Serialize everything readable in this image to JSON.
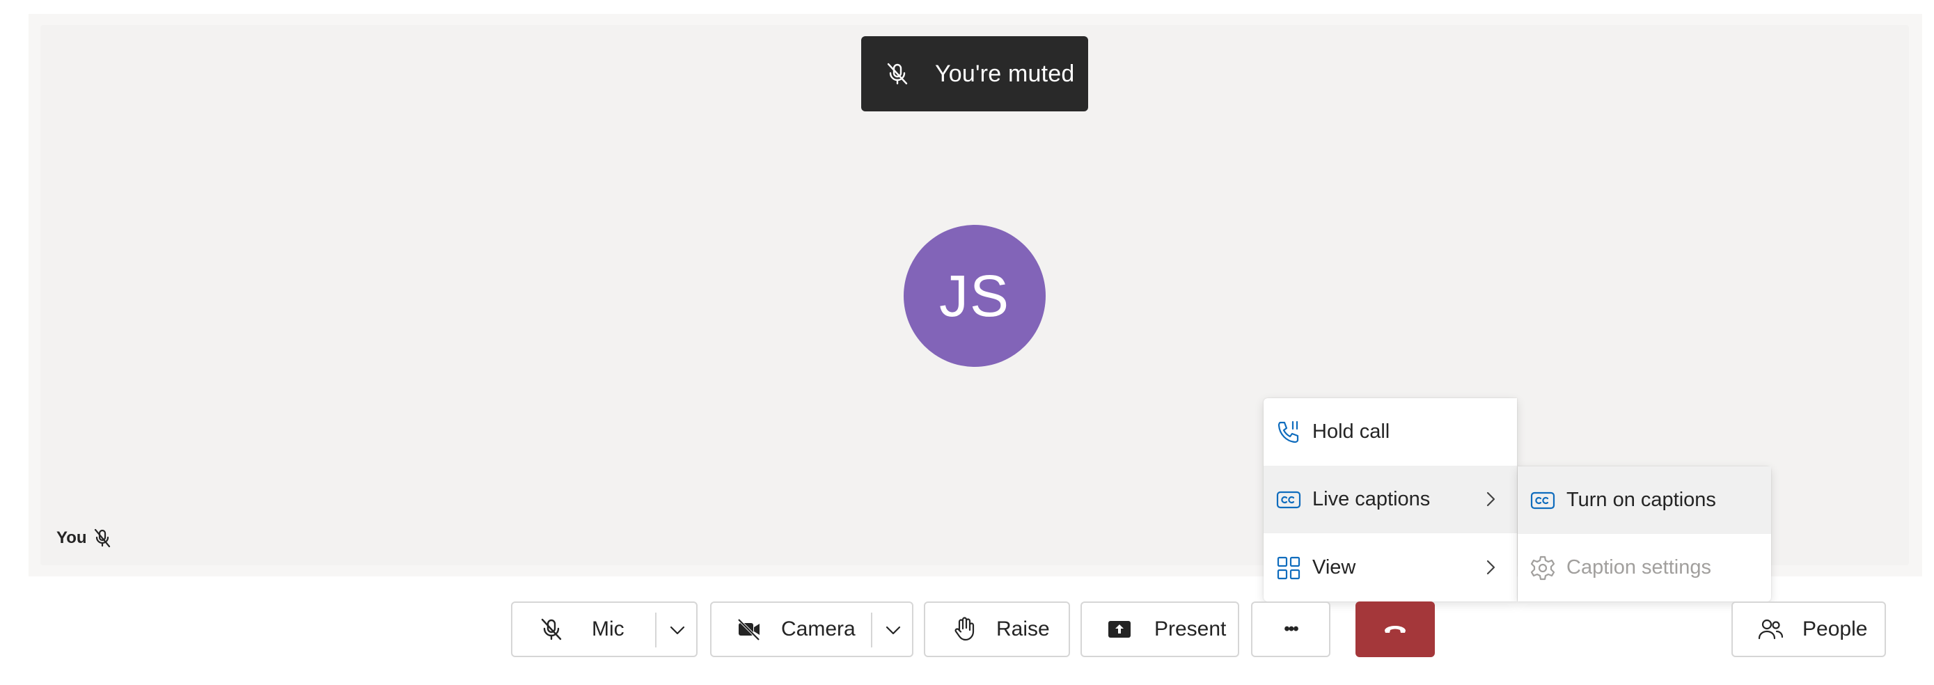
{
  "toast": {
    "text": "You're muted",
    "icon": "mic-off-icon"
  },
  "participant": {
    "initials": "JS",
    "avatar_color": "#8264b8",
    "self_label": "You",
    "self_icon": "mic-off-icon"
  },
  "more_menu": {
    "items": [
      {
        "label": "Hold call",
        "icon": "phone-hold-icon"
      },
      {
        "label": "Live captions",
        "icon": "closed-captions-icon",
        "has_submenu": true,
        "highlighted": true
      },
      {
        "label": "View",
        "icon": "grid-view-icon",
        "has_submenu": true
      }
    ]
  },
  "captions_submenu": {
    "items": [
      {
        "label": "Turn on captions",
        "icon": "closed-captions-icon",
        "highlighted": true
      },
      {
        "label": "Caption settings",
        "icon": "gear-icon",
        "disabled": true
      }
    ]
  },
  "toolbar": {
    "mic_label": "Mic",
    "camera_label": "Camera",
    "raise_label": "Raise",
    "present_label": "Present",
    "more_label": "•••",
    "people_label": "People"
  },
  "colors": {
    "stage_bg": "#f3f2f1",
    "toast_bg": "#292929",
    "hangup": "#a4373a",
    "accent_icon": "#0f6cbd"
  }
}
